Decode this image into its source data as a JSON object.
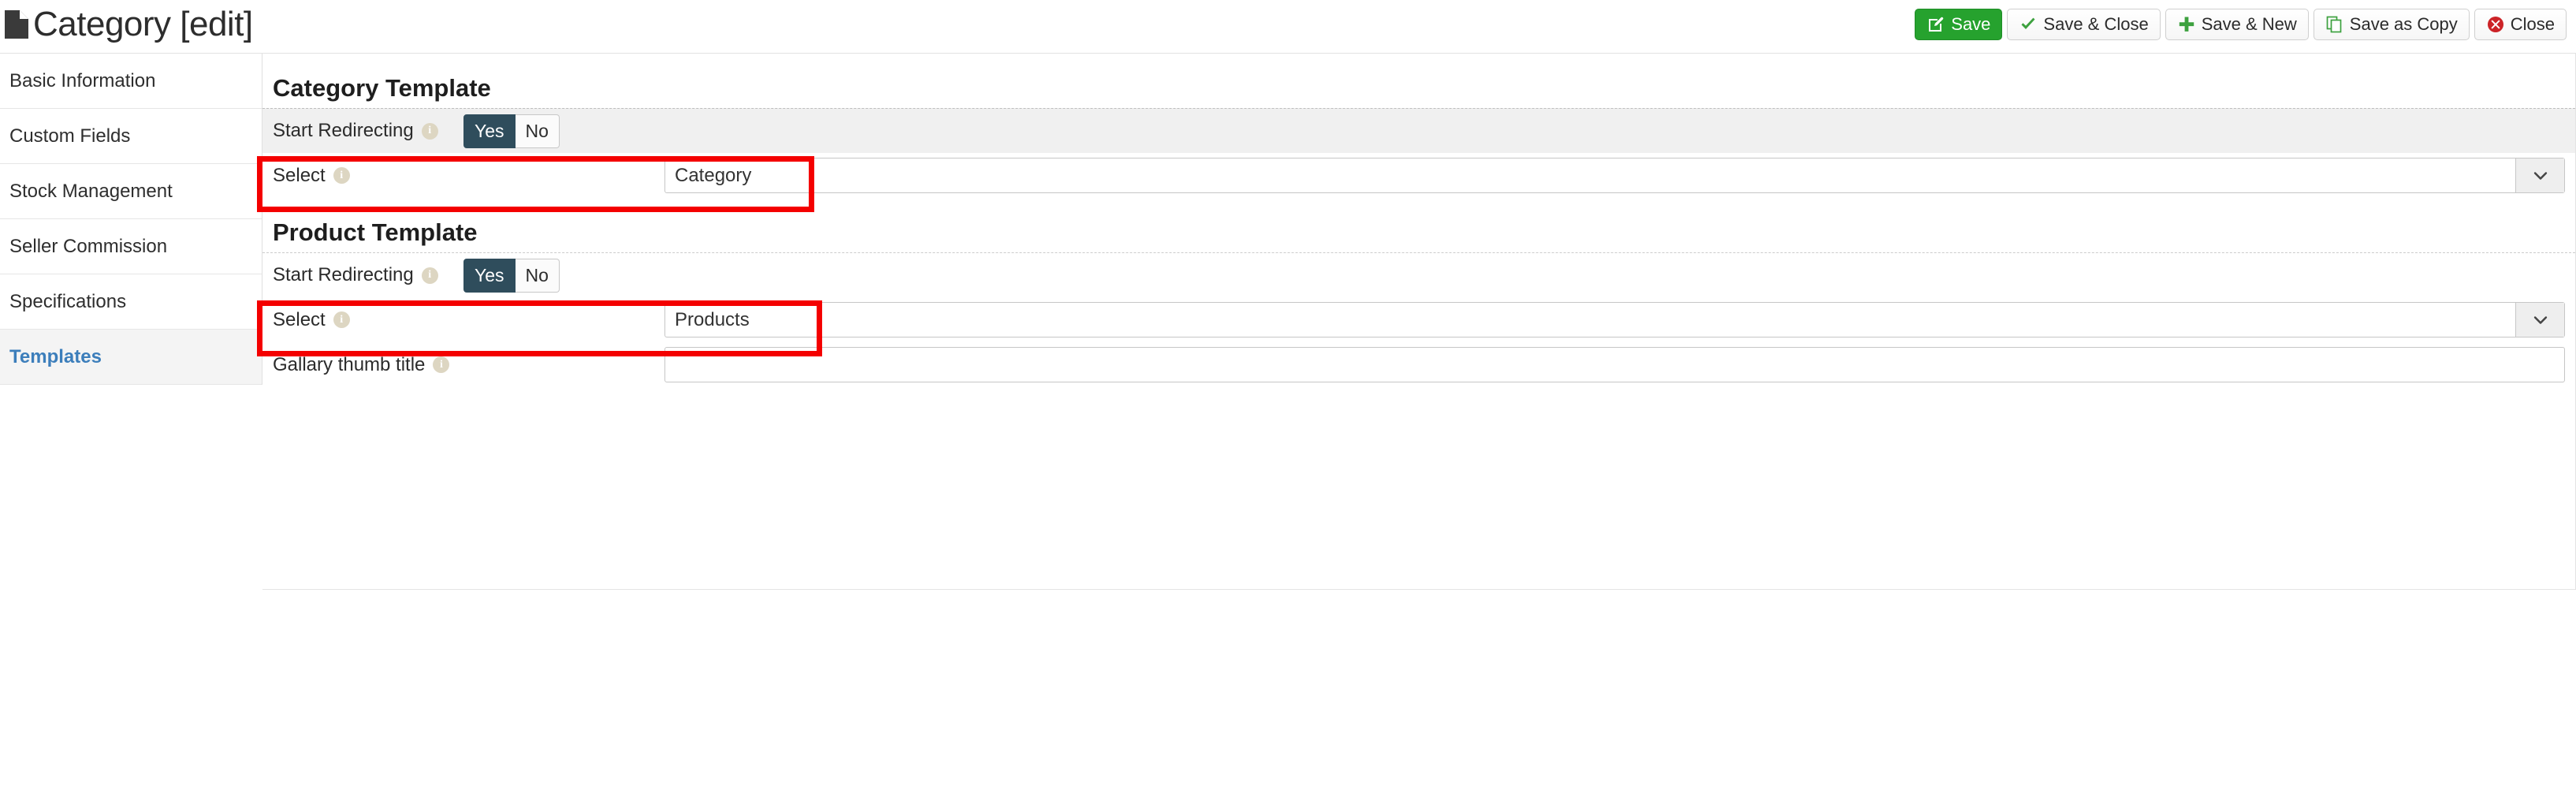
{
  "header": {
    "title": "Category [edit]",
    "doc_icon": "document-icon",
    "toolbar": [
      {
        "label": "Save",
        "icon": "edit-square-icon",
        "style": "primary"
      },
      {
        "label": "Save & Close",
        "icon": "check-icon",
        "style": "default"
      },
      {
        "label": "Save & New",
        "icon": "plus-icon",
        "style": "default"
      },
      {
        "label": "Save as Copy",
        "icon": "copy-icon",
        "style": "default"
      },
      {
        "label": "Close",
        "icon": "close-circle-icon",
        "style": "default"
      }
    ]
  },
  "sidebar": {
    "items": [
      {
        "label": "Basic Information",
        "active": false
      },
      {
        "label": "Custom Fields",
        "active": false
      },
      {
        "label": "Stock Management",
        "active": false
      },
      {
        "label": "Seller Commission",
        "active": false
      },
      {
        "label": "Specifications",
        "active": false
      },
      {
        "label": "Templates",
        "active": true
      }
    ]
  },
  "main": {
    "category_section": {
      "heading": "Category Template",
      "redirect_label": "Start Redirecting",
      "toggle_yes": "Yes",
      "toggle_no": "No",
      "toggle_value": "Yes",
      "select_label": "Select",
      "select_value": "Category"
    },
    "product_section": {
      "heading": "Product Template",
      "redirect_label": "Start Redirecting",
      "toggle_yes": "Yes",
      "toggle_no": "No",
      "toggle_value": "Yes",
      "select_label": "Select",
      "select_value": "Products",
      "gallery_label": "Gallary thumb title",
      "gallery_value": "",
      "gallery_placeholder": ""
    }
  },
  "colors": {
    "accent_green": "#26a22e",
    "toggle_active": "#2f4d5c",
    "active_nav": "#3c7ebb",
    "annotation_red": "#f40000",
    "close_red": "#cc2327",
    "info_icon": "#ddd6c2"
  }
}
